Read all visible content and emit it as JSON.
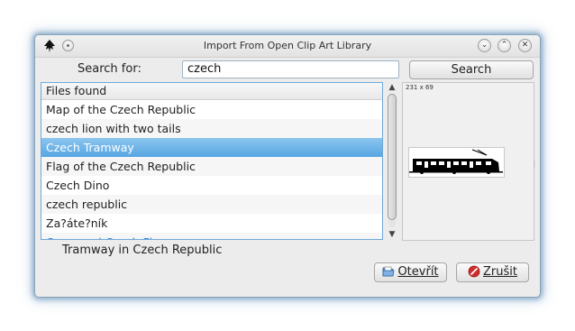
{
  "window": {
    "title": "Import From Open Clip Art Library",
    "controls": {
      "minimize": "⌄",
      "maximize": "⌃",
      "close": "✕"
    }
  },
  "search": {
    "label": "Search for:",
    "value": "czech",
    "button_label": "Search"
  },
  "files": {
    "header": "Files found",
    "items": [
      "Map of the Czech Republic",
      "czech lion with two tails",
      "Czech Tramway",
      "Flag of the Czech Republic",
      "Czech Dino",
      "czech republic",
      "Za?áte?ník",
      "Cross and Czech Flag"
    ],
    "selected_index": 2
  },
  "preview": {
    "dimensions": "231 x 69",
    "icon": "tram-silhouette"
  },
  "description": "Tramway in Czech Republic",
  "buttons": {
    "open_label": "Otevřít",
    "cancel_label": "Zrušit"
  },
  "icons": {
    "app": "inkscape-icon",
    "open": "document-open-icon",
    "cancel": "cancel-icon"
  },
  "colors": {
    "selection": "#56a6e2",
    "list_border": "#6fa8d9",
    "cancel_icon": "#d22b2b"
  }
}
